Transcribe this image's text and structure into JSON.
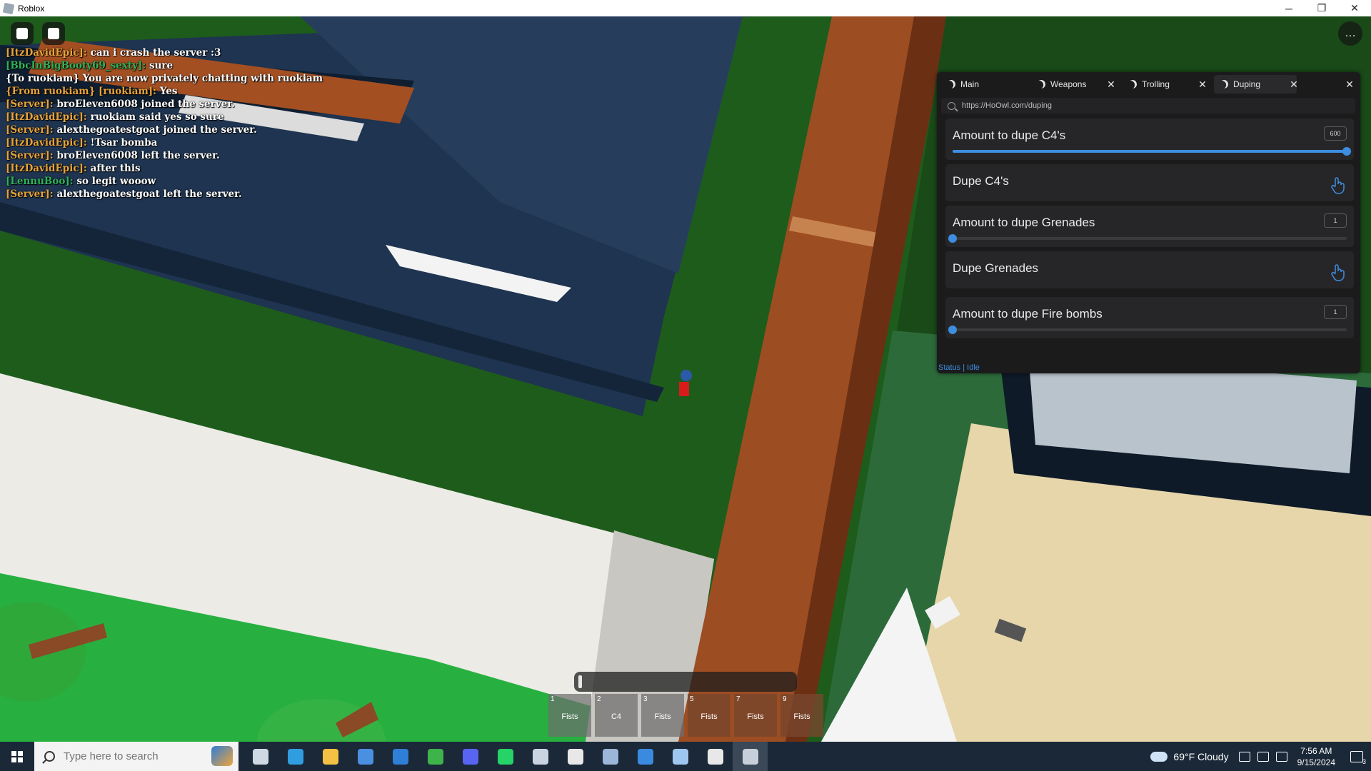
{
  "window": {
    "title": "Roblox",
    "minimize": "─",
    "maximize": "❐",
    "close": "✕"
  },
  "top_menu_icon": "…",
  "chat": [
    {
      "speaker": "[ItzDavidEpic]:",
      "speaker_color": "#e8a33a",
      "message": "can i crash the server :3"
    },
    {
      "speaker": "[BbcInBigBooty69_sexty]:",
      "speaker_color": "#2fb35a",
      "message": "sure"
    },
    {
      "speaker": "",
      "speaker_color": "#ffffff",
      "message": "{To ruokiam} You are now privately chatting with ruokiam"
    },
    {
      "speaker": "{From ruokiam} [ruokiam]:",
      "speaker_color": "#e8a33a",
      "message": "Yes"
    },
    {
      "speaker": "[Server]:",
      "speaker_color": "#e8a33a",
      "message": "broEleven6008 joined the server."
    },
    {
      "speaker": "[ItzDavidEpic]:",
      "speaker_color": "#e8a33a",
      "message": "ruokiam said yes so sure"
    },
    {
      "speaker": "[Server]:",
      "speaker_color": "#e8a33a",
      "message": "alexthegoatestgoat joined the server."
    },
    {
      "speaker": "[ItzDavidEpic]:",
      "speaker_color": "#e8a33a",
      "message": "!Tsar bomba"
    },
    {
      "speaker": "[Server]:",
      "speaker_color": "#e8a33a",
      "message": "broEleven6008 left the server."
    },
    {
      "speaker": "[ItzDavidEpic]:",
      "speaker_color": "#e8a33a",
      "message": "after this"
    },
    {
      "speaker": "[LennuBoo]:",
      "speaker_color": "#2fb35a",
      "message": "so legit wooow"
    },
    {
      "speaker": "[Server]:",
      "speaker_color": "#e8a33a",
      "message": "alexthegoatestgoat left the server."
    }
  ],
  "gui": {
    "tabs": [
      {
        "label": "Main"
      },
      {
        "label": "Weapons"
      },
      {
        "label": "Trolling"
      },
      {
        "label": "Duping"
      }
    ],
    "close_glyph": "✕",
    "url": "https://HoOwl.com/duping",
    "rows": [
      {
        "type": "slider",
        "label": "Amount to dupe C4's",
        "value": "600",
        "fraction": 1.0
      },
      {
        "type": "button",
        "label": "Dupe C4's"
      },
      {
        "type": "slider",
        "label": "Amount to dupe Grenades",
        "value": "1",
        "fraction": 0.0
      },
      {
        "type": "button",
        "label": "Dupe Grenades"
      },
      {
        "type": "slider",
        "label": "Amount to dupe Fire bombs",
        "value": "1",
        "fraction": 0.0
      }
    ],
    "status": "Status | Idle",
    "accent": "#3d8ee0"
  },
  "hotbar": [
    {
      "num": "1",
      "name": "Fists",
      "equipped": false
    },
    {
      "num": "2",
      "name": "C4",
      "equipped": false
    },
    {
      "num": "3",
      "name": "Fists",
      "equipped": false
    },
    {
      "num": "5",
      "name": "Fists",
      "equipped": true
    },
    {
      "num": "7",
      "name": "Fists",
      "equipped": true
    },
    {
      "num": "9",
      "name": "Fists",
      "equipped": true
    }
  ],
  "taskbar": {
    "search_placeholder": "Type here to search",
    "apps": [
      "task-view-icon",
      "edge-icon",
      "file-explorer-icon",
      "store-icon",
      "mail-icon",
      "hoyo-icon",
      "discord-icon",
      "whatsapp-icon",
      "photos-icon",
      "security-icon",
      "calculator-icon",
      "snipping-icon",
      "window-icon",
      "star-icon",
      "roblox-icon"
    ],
    "weather": "69°F  Cloudy",
    "time": "7:56 AM",
    "date": "9/15/2024",
    "notifications": "3"
  }
}
